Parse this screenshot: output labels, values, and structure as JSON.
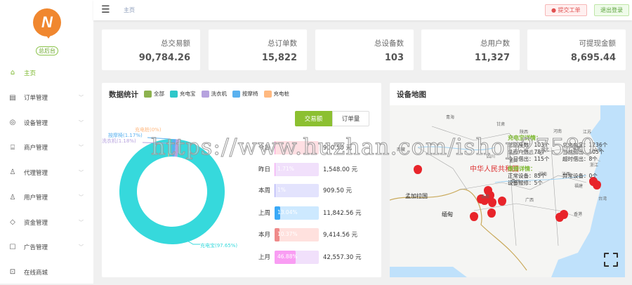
{
  "sidebar": {
    "logo_letter": "N",
    "role_badge": "总后台",
    "items": [
      {
        "label": "主页",
        "icon": "home-icon",
        "glyph": "⌂",
        "active": true,
        "expandable": false
      },
      {
        "label": "订单管理",
        "icon": "order-icon",
        "glyph": "▤",
        "expandable": true
      },
      {
        "label": "设备管理",
        "icon": "device-icon",
        "glyph": "◎",
        "expandable": true
      },
      {
        "label": "商户管理",
        "icon": "store-icon",
        "glyph": "⌸",
        "expandable": true
      },
      {
        "label": "代理管理",
        "icon": "agent-icon",
        "glyph": "♙",
        "expandable": true
      },
      {
        "label": "用户管理",
        "icon": "user-icon",
        "glyph": "♙",
        "expandable": true
      },
      {
        "label": "资金管理",
        "icon": "funds-icon",
        "glyph": "◇",
        "expandable": true
      },
      {
        "label": "广告管理",
        "icon": "ad-icon",
        "glyph": "☐",
        "expandable": true
      },
      {
        "label": "在线商城",
        "icon": "shop-icon",
        "glyph": "⊡",
        "expandable": false
      }
    ]
  },
  "header": {
    "breadcrumb": "主页",
    "ticket_button": "提交工单",
    "logout_button": "退出登录"
  },
  "cards": [
    {
      "label": "总交易额",
      "value": "90,784.26",
      "icon": "transaction-chart-icon"
    },
    {
      "label": "总订单数",
      "value": "15,822",
      "icon": "order-clipboard-icon"
    },
    {
      "label": "总设备数",
      "value": "103",
      "icon": "device-phone-icon"
    },
    {
      "label": "总用户数",
      "value": "11,327",
      "icon": "user-growth-icon"
    },
    {
      "label": "可提现金额",
      "value": "8,695.44",
      "icon": "wallet-icon"
    }
  ],
  "stats": {
    "title": "数据统计",
    "legend": [
      {
        "label": "全部",
        "color": "#8db24e"
      },
      {
        "label": "充电宝",
        "color": "#2ec7c9"
      },
      {
        "label": "洗衣机",
        "color": "#b6a2de"
      },
      {
        "label": "按摩椅",
        "color": "#5ab1ef"
      },
      {
        "label": "充电桩",
        "color": "#ffb980"
      }
    ],
    "toggle": {
      "active": "交易额",
      "inactive": "订单量"
    },
    "rows": [
      {
        "label": "今日",
        "percent": "",
        "value": "900.50 元",
        "fill": 1,
        "color": "#ff9bd6",
        "track": "#ffdfe3"
      },
      {
        "label": "昨日",
        "percent": "1.71%",
        "value": "1,548.00 元",
        "fill": 1.71,
        "color": "#f59ff0",
        "track": "#f1e0fb"
      },
      {
        "label": "本周",
        "percent": "1%",
        "value": "909.50 元",
        "fill": 1,
        "color": "#a9a9f5",
        "track": "#e3e3fd"
      },
      {
        "label": "上周",
        "percent": "13.04%",
        "value": "11,842.56 元",
        "fill": 13.04,
        "color": "#3aa9f7",
        "track": "#cde9ff"
      },
      {
        "label": "本月",
        "percent": "10.37%",
        "value": "9,414.56 元",
        "fill": 10.37,
        "color": "#ef8a8a",
        "track": "#ffe1de"
      },
      {
        "label": "上月",
        "percent": "46.88%",
        "value": "42,557.30 元",
        "fill": 46.88,
        "color": "#f99df3",
        "track": "#f1e0fb"
      }
    ]
  },
  "chart_data": {
    "type": "pie",
    "donut": true,
    "slices": [
      {
        "name": "充电宝",
        "label": "充电宝(97.65%)",
        "value": 97.65,
        "color": "#36d9dc"
      },
      {
        "name": "洗衣机",
        "label": "洗衣机(1.18%)",
        "value": 1.18,
        "color": "#b6a2de"
      },
      {
        "name": "按摩椅",
        "label": "按摩椅(1.17%)",
        "value": 1.17,
        "color": "#5ab1ef"
      },
      {
        "name": "充电桩",
        "label": "充电桩(0%)",
        "value": 0,
        "color": "#ffb980"
      }
    ]
  },
  "map": {
    "title": "设备地图",
    "country_label": "中华人民共和国",
    "charger_title": "充电宝详情：",
    "charger": [
      "总底座数：103个",
      "总充电宝：1236个",
      "总商户数：78个",
      "当前借出：105个",
      "今日借出：115个",
      "超时借出：8个"
    ],
    "maint_title": "维修详情：",
    "maint": [
      "正常设备：85个",
      "异常设备：0个",
      "设备报修：5个"
    ],
    "places": [
      "青海",
      "甘肃",
      "陕西",
      "河南",
      "江苏",
      "西藏",
      "四川",
      "湖北",
      "安徽",
      "上海",
      "重庆",
      "浙江",
      "湖南",
      "江西",
      "贵州",
      "福建",
      "云南",
      "广西",
      "台湾",
      "孟加拉国",
      "缅甸",
      "香港"
    ]
  },
  "watermark": "https://www.huzhan.com/ishop27580"
}
